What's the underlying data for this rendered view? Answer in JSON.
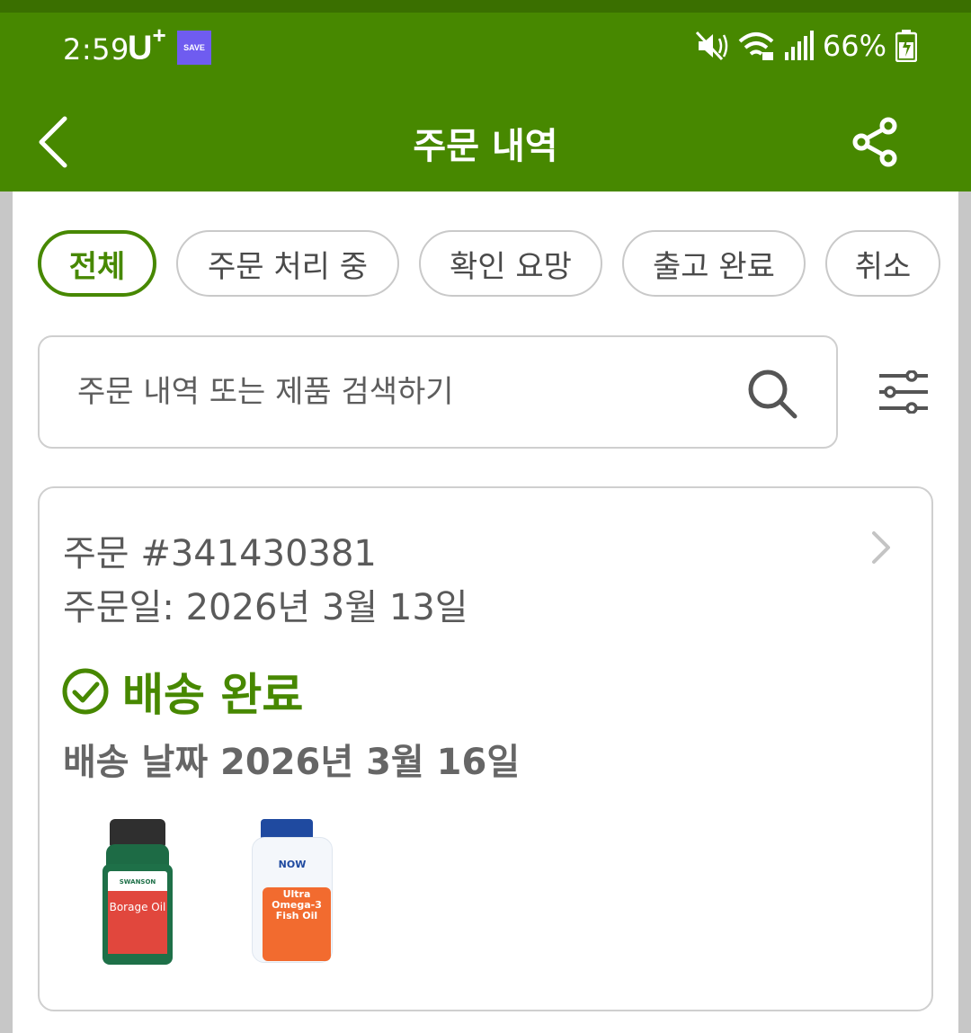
{
  "status_bar": {
    "time": "2:59",
    "carrier": "U",
    "carrier_sup": "+",
    "save_badge": "SAVE",
    "battery": "66%"
  },
  "app_bar": {
    "title": "주문 내역"
  },
  "filters": [
    {
      "label": "전체",
      "active": true
    },
    {
      "label": "주문 처리 중",
      "active": false
    },
    {
      "label": "확인 요망",
      "active": false
    },
    {
      "label": "출고 완료",
      "active": false
    },
    {
      "label": "취소",
      "active": false
    }
  ],
  "search": {
    "placeholder": "주문 내역 또는 제품 검색하기",
    "value": ""
  },
  "order": {
    "number": "주문 #341430381",
    "order_date": "주문일: 2026년 3월 13일",
    "status": "배송 완료",
    "delivery_date": "배송 날짜 2026년 3월 16일",
    "products": [
      {
        "brand": "SWANSON",
        "name": "Borage Oil"
      },
      {
        "brand": "NOW",
        "name": "Ultra Omega-3 Fish Oil"
      }
    ]
  },
  "colors": {
    "brand_green": "#478800",
    "status_bar_green": "#3a6f00"
  }
}
